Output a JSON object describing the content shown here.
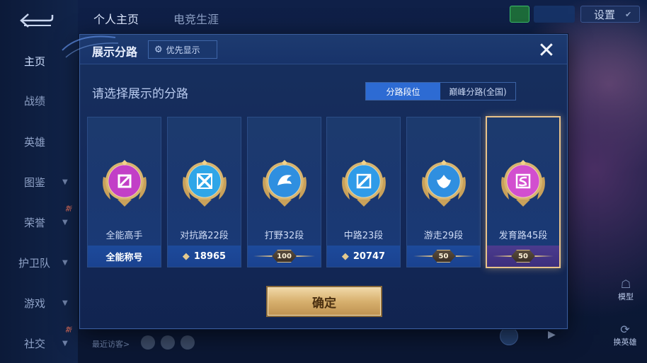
{
  "nav": {
    "tabs": [
      "个人主页",
      "电竞生涯"
    ],
    "settings_label": "设置",
    "side_items": [
      {
        "label": "主页",
        "active": true,
        "chevron": false,
        "new": false
      },
      {
        "label": "战绩",
        "active": false,
        "chevron": false,
        "new": false
      },
      {
        "label": "英雄",
        "active": false,
        "chevron": false,
        "new": false
      },
      {
        "label": "图鉴",
        "active": false,
        "chevron": true,
        "new": false
      },
      {
        "label": "荣誉",
        "active": false,
        "chevron": true,
        "new": true
      },
      {
        "label": "护卫队",
        "active": false,
        "chevron": true,
        "new": false
      },
      {
        "label": "游戏",
        "active": false,
        "chevron": true,
        "new": false
      },
      {
        "label": "社交",
        "active": false,
        "chevron": true,
        "new": true
      }
    ],
    "new_badge": "新",
    "visitors_label": "最近访客>",
    "right_model": "模型",
    "right_swap": "换英雄"
  },
  "modal": {
    "title": "展示分路",
    "priority_label": "优先显示",
    "subtitle": "请选择展示的分路",
    "segment": {
      "active": "分路段位",
      "inactive": "巅峰分路(全国)"
    },
    "confirm_label": "确定",
    "cards": [
      {
        "name": "全能高手",
        "footer_type": "text",
        "footer": "全能称号",
        "emblem": "allround-emblem-icon",
        "color": "#c23fc7",
        "selected": false
      },
      {
        "name": "对抗路22段",
        "footer_type": "score",
        "footer": "18965",
        "emblem": "clash-lane-emblem-icon",
        "color": "#2fa6e8",
        "selected": false
      },
      {
        "name": "打野32段",
        "footer_type": "rank",
        "footer": "100",
        "emblem": "jungle-emblem-icon",
        "color": "#2f8fe0",
        "selected": false
      },
      {
        "name": "中路23段",
        "footer_type": "score",
        "footer": "20747",
        "emblem": "mid-lane-emblem-icon",
        "color": "#2f9be8",
        "selected": false
      },
      {
        "name": "游走29段",
        "footer_type": "rank",
        "footer": "50",
        "emblem": "roam-emblem-icon",
        "color": "#2f8fe0",
        "selected": false
      },
      {
        "name": "发育路45段",
        "footer_type": "rank",
        "footer": "50",
        "emblem": "farm-lane-emblem-icon",
        "color": "#d24fcf",
        "selected": true
      }
    ]
  },
  "colors": {
    "accent": "#2d6bd3",
    "selected_border": "#e9c38a",
    "confirm_gold": "#d7b06e"
  }
}
